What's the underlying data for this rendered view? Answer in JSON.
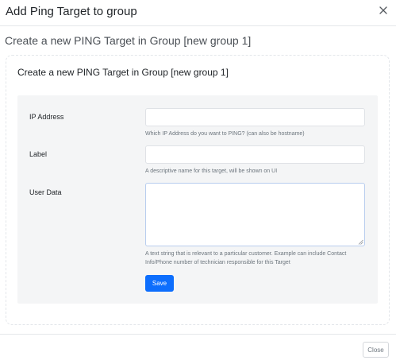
{
  "modal": {
    "title": "Add Ping Target to group",
    "close_icon": "close-icon"
  },
  "page": {
    "heading": "Create a new PING Target in Group [new group 1]"
  },
  "card": {
    "title": "Create a new PING Target in Group [new group 1]"
  },
  "form": {
    "ip_address": {
      "label": "IP Address",
      "value": "",
      "help": "Which IP Address do you want to PING? (can also be hostname)"
    },
    "label_field": {
      "label": "Label",
      "value": "",
      "help": "A descriptive name for this target, will be shown on UI"
    },
    "user_data": {
      "label": "User Data",
      "value": "",
      "help": "A text string that is relevant to a particular customer. Example can include Contact Info/Phone number of technician responsible for this Target"
    },
    "save_label": "Save"
  },
  "footer": {
    "close_label": "Close"
  },
  "colors": {
    "primary": "#0d6efd",
    "panel_bg": "#f4f5f6",
    "muted_text": "#6c757d"
  }
}
